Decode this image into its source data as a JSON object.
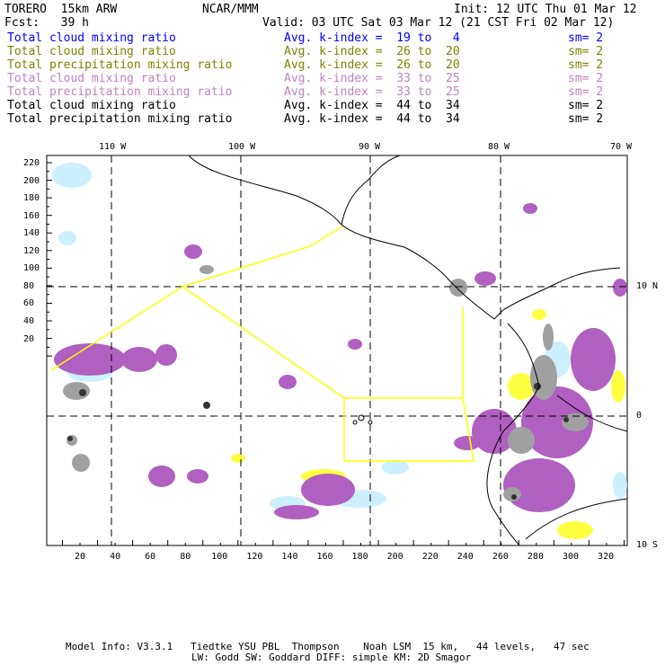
{
  "header": {
    "model": "TORERO  15km ARW",
    "org": "NCAR/MMM",
    "init": "Init: 12 UTC Thu 01 Mar 12",
    "fcst": "Fcst:   39 h",
    "valid": "Valid: 03 UTC Sat 03 Mar 12 (21 CST Fri 02 Mar 12)"
  },
  "legend": [
    {
      "field": "Total cloud mixing ratio",
      "index": "Avg. k-index =  19 to   4",
      "sm": "sm= 2",
      "color": "#0000ff"
    },
    {
      "field": "Total cloud mixing ratio",
      "index": "Avg. k-index =  26 to  20",
      "sm": "sm= 2",
      "color": "#808000"
    },
    {
      "field": "Total precipitation mixing ratio",
      "index": "Avg. k-index =  26 to  20",
      "sm": "sm= 2",
      "color": "#808000"
    },
    {
      "field": "Total cloud mixing ratio",
      "index": "Avg. k-index =  33 to  25",
      "sm": "sm= 2",
      "color": "#c080c0"
    },
    {
      "field": "Total precipitation mixing ratio",
      "index": "Avg. k-index =  33 to  25",
      "sm": "sm= 2",
      "color": "#c080c0"
    },
    {
      "field": "Total cloud mixing ratio",
      "index": "Avg. k-index =  44 to  34",
      "sm": "sm= 2",
      "color": "#000000"
    },
    {
      "field": "Total precipitation mixing ratio",
      "index": "Avg. k-index =  44 to  34",
      "sm": "sm= 2",
      "color": "#000000"
    }
  ],
  "map": {
    "top_lon_labels": [
      "110 W",
      "100 W",
      "90 W",
      "80 W",
      "70 W"
    ],
    "right_lat_labels": [
      "10 N",
      "0",
      "10 S"
    ],
    "left_ticks": [
      "220",
      "200",
      "180",
      "160",
      "140",
      "120",
      "100",
      "80",
      "60",
      "40",
      "20"
    ],
    "bottom_ticks": [
      "20",
      "40",
      "60",
      "80",
      "100",
      "120",
      "140",
      "160",
      "180",
      "200",
      "220",
      "240",
      "260",
      "280",
      "300",
      "320"
    ],
    "colors": {
      "light_blue": "#ccf0ff",
      "yellow": "#ffff40",
      "purple": "#b060c0",
      "gray": "#a0a0a0",
      "box": "#ffff00"
    }
  },
  "footer": {
    "line1": "Model Info: V3.3.1   Tiedtke YSU PBL  Thompson    Noah LSM  15 km,   44 levels,   47 sec",
    "line2": "LW: Godd SW: Goddard DIFF: simple KM: 2D Smagor"
  }
}
